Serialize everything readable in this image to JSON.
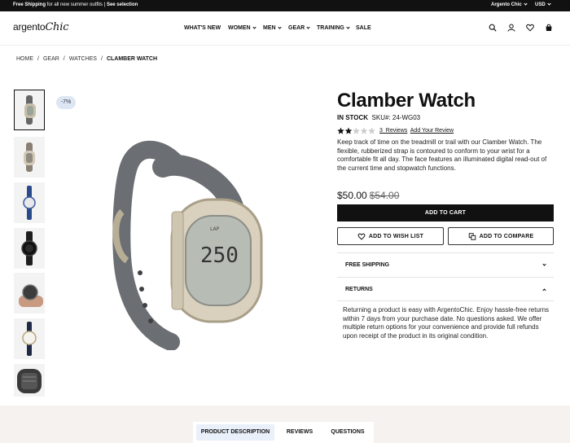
{
  "topbar": {
    "promo_bold": "Free Shipping",
    "promo_text": " for all new summer outfits | ",
    "promo_link": "See selection",
    "store": "Argento Chic",
    "currency": "USD"
  },
  "header": {
    "logo_main": "argento",
    "logo_script": "Chic",
    "nav": [
      "WHAT'S NEW",
      "WOMEN",
      "MEN",
      "GEAR",
      "TRAINING",
      "SALE"
    ],
    "icons": [
      "search-icon",
      "account-icon",
      "wishlist-icon",
      "cart-icon"
    ]
  },
  "breadcrumb": [
    "HOME",
    "GEAR",
    "WATCHES",
    "CLAMBER WATCH"
  ],
  "gallery": {
    "discount_badge": "-7%"
  },
  "product": {
    "title": "Clamber Watch",
    "stock": "IN STOCK",
    "sku_label": "SKU#:",
    "sku": "24-WG03",
    "rating_fraction": 0.5,
    "review_count": "3",
    "reviews_label": "Reviews",
    "add_review": "Add Your Review",
    "description": "Keep track of time on the treadmill or trail with our Clamber Watch. The flexible, rubberized strap is contoured to conform to your wrist for a comfortable fit all day. The face features an illuminated digital read-out of the current time and stopwatch functions.",
    "price": "$50.00",
    "old_price": "$54.00",
    "add_to_cart": "ADD TO CART",
    "wishlist": "ADD TO WISH LIST",
    "compare": "ADD TO COMPARE"
  },
  "accordion": {
    "shipping": "FREE SHIPPING",
    "returns": "RETURNS",
    "returns_text": "Returning a product is easy with ArgentoChic. Enjoy hassle-free returns within 7 days from your purchase date. No questions asked. We offer multiple return options for your convenience and provide full refunds upon receipt of the product in its original condition."
  },
  "tabs": [
    "PRODUCT DESCRIPTION",
    "REVIEWS",
    "QUESTIONS"
  ],
  "colors": {
    "accent": "#111111",
    "tab_active": "#eaf0fa",
    "badge": "#dde7f3"
  }
}
